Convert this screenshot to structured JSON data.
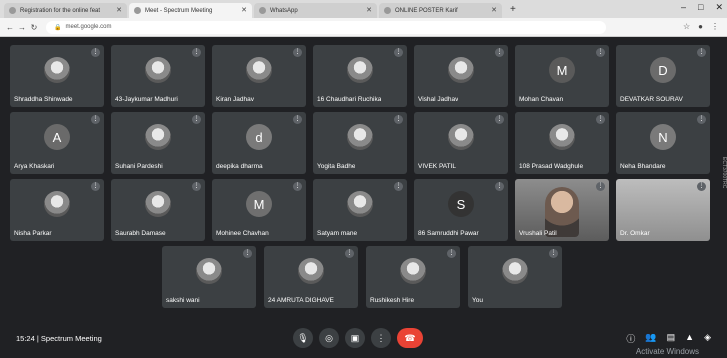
{
  "browser": {
    "tabs": [
      {
        "title": "Registration for the online feat",
        "active": false
      },
      {
        "title": "Meet - Spectrum Meeting",
        "active": true
      },
      {
        "title": "WhatsApp",
        "active": false
      },
      {
        "title": "ONLINE POSTER Karif",
        "active": false
      }
    ],
    "new_tab": "+",
    "url": "meet.google.com"
  },
  "meeting": {
    "time": "15:24",
    "separator": "|",
    "title": "Spectrum Meeting",
    "side_label": "ECT3700TRC"
  },
  "participants": [
    {
      "name": "Shraddha Shinwade",
      "initial": "",
      "type": "photo",
      "color": "#777777"
    },
    {
      "name": "43-Jaykumar Madhuri",
      "initial": "",
      "type": "photo",
      "color": "#777777"
    },
    {
      "name": "Kiran Jadhav",
      "initial": "",
      "type": "photo",
      "color": "#777777"
    },
    {
      "name": "16 Chaudhari Ruchika",
      "initial": "",
      "type": "photo",
      "color": "#777777"
    },
    {
      "name": "Vishal Jadhav",
      "initial": "",
      "type": "photo",
      "color": "#777777"
    },
    {
      "name": "Mohan Chavan",
      "initial": "M",
      "type": "text",
      "color": "#5a5a5a"
    },
    {
      "name": "DEVATKAR SOURAV",
      "initial": "D",
      "type": "text",
      "color": "#6b6b6b"
    },
    {
      "name": "Arya Khaskari",
      "initial": "A",
      "type": "text",
      "color": "#6a6a6a"
    },
    {
      "name": "Suhani Pardeshi",
      "initial": "",
      "type": "photo",
      "color": "#777777"
    },
    {
      "name": "deepika dharma",
      "initial": "d",
      "type": "text",
      "color": "#7a7a7a"
    },
    {
      "name": "Yogita Badhe",
      "initial": "",
      "type": "photo",
      "color": "#777777"
    },
    {
      "name": "VIVEK PATIL",
      "initial": "",
      "type": "photo",
      "color": "#777777"
    },
    {
      "name": "108 Prasad Wadghule",
      "initial": "",
      "type": "photo",
      "color": "#777777"
    },
    {
      "name": "Neha Bhandare",
      "initial": "N",
      "type": "text",
      "color": "#7a7a7a"
    },
    {
      "name": "Nisha Parkar",
      "initial": "",
      "type": "photo",
      "color": "#777777"
    },
    {
      "name": "Saurabh Damase",
      "initial": "",
      "type": "photo",
      "color": "#777777"
    },
    {
      "name": "Mohinee Chavhan",
      "initial": "M",
      "type": "text",
      "color": "#6f6f6f"
    },
    {
      "name": "Satyam mane",
      "initial": "",
      "type": "photo",
      "color": "#777777"
    },
    {
      "name": "86 Samruddhi Pawar",
      "initial": "S",
      "type": "text",
      "color": "#333333"
    },
    {
      "name": "Vrushali Patil",
      "initial": "",
      "type": "video",
      "color": "#777777"
    },
    {
      "name": "Dr. Omkar",
      "initial": "",
      "type": "video2",
      "color": "#777777"
    },
    {
      "name": "sakshi wani",
      "initial": "",
      "type": "photo",
      "color": "#777777"
    },
    {
      "name": "24 AMRUTA DIGHAVE",
      "initial": "",
      "type": "photo",
      "color": "#777777"
    },
    {
      "name": "Rushikesh Hire",
      "initial": "",
      "type": "photo",
      "color": "#777777"
    },
    {
      "name": "You",
      "initial": "",
      "type": "photo",
      "color": "#777777"
    }
  ],
  "windows_notice": "Activate Windows",
  "colors": {
    "end_call": "#ea4335",
    "tile": "#3c4043",
    "background": "#202124"
  }
}
